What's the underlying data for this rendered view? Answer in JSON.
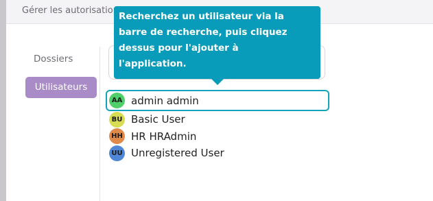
{
  "header": {
    "title": "Gérer les autorisations"
  },
  "sidebar": {
    "items": [
      {
        "label": "Dossiers",
        "active": false
      },
      {
        "label": "Utilisateurs",
        "active": true
      }
    ]
  },
  "search": {
    "placeholder": ""
  },
  "tooltip": {
    "lines": [
      "Recherchez un utilisateur via la",
      "barre de recherche, puis cliquez",
      "dessus pour l'ajouter à",
      "l'application."
    ]
  },
  "users": [
    {
      "initials": "AA",
      "name": "admin admin",
      "avatar_color": "#4fcf6a",
      "highlighted": true
    },
    {
      "initials": "BU",
      "name": "Basic User",
      "avatar_color": "#d7dc52",
      "highlighted": false
    },
    {
      "initials": "HH",
      "name": "HR HRAdmin",
      "avatar_color": "#e08a4a",
      "highlighted": false
    },
    {
      "initials": "UU",
      "name": "Unregistered User",
      "avatar_color": "#4f86d6",
      "highlighted": false
    }
  ],
  "colors": {
    "accent": "#089cba",
    "nav_active": "#a98bc8",
    "highlight_border": "#12a3bd"
  }
}
